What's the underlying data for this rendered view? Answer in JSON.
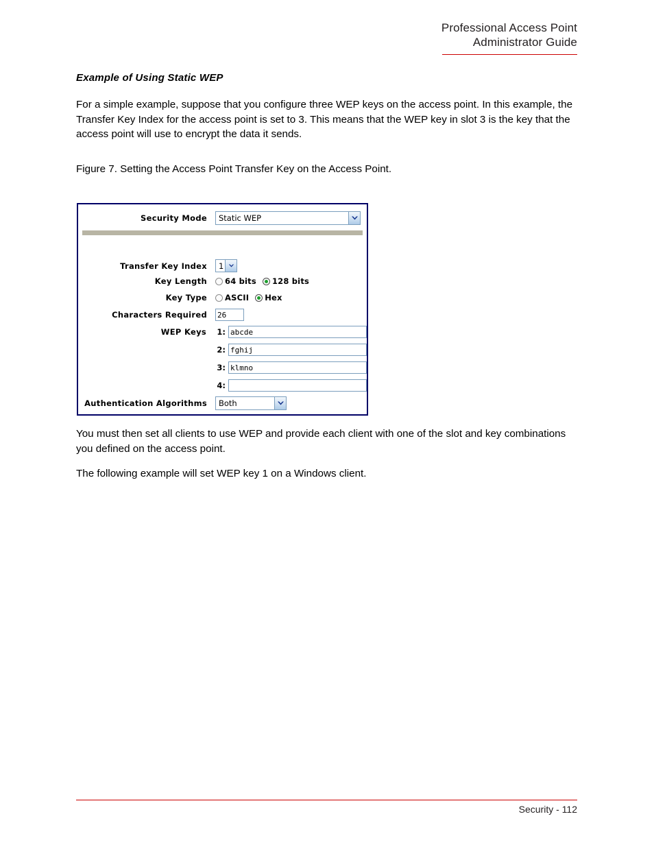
{
  "header": {
    "line1": "Professional Access Point",
    "line2": "Administrator Guide"
  },
  "content": {
    "section_heading": "Example of Using Static WEP",
    "intro_paragraph": "For a simple example, suppose that you configure three WEP keys on the access point. In this example, the Transfer Key Index for the access point is set to 3. This means that the WEP key in slot 3 is the key that the access point will use to encrypt the data it sends.",
    "figure_caption": "Figure 7. Setting the Access Point Transfer Key on the Access Point.",
    "after_paragraph": "You must then set all clients to use WEP and provide each client with one of the slot and key combinations you defined on the access point.",
    "last_paragraph": "The following example will set WEP key 1 on a Windows client."
  },
  "figure": {
    "security_mode": {
      "label": "Security Mode",
      "value": "Static WEP"
    },
    "transfer_key_index": {
      "label": "Transfer Key Index",
      "value": "1"
    },
    "key_length": {
      "label": "Key Length",
      "options": [
        {
          "label": "64 bits",
          "selected": false
        },
        {
          "label": "128 bits",
          "selected": true
        }
      ]
    },
    "key_type": {
      "label": "Key Type",
      "options": [
        {
          "label": "ASCII",
          "selected": false
        },
        {
          "label": "Hex",
          "selected": true
        }
      ]
    },
    "characters_required": {
      "label": "Characters Required",
      "value": "26"
    },
    "wep_keys": {
      "label": "WEP Keys",
      "rows": [
        {
          "num": "1:",
          "value": "abcde"
        },
        {
          "num": "2:",
          "value": "fghij"
        },
        {
          "num": "3:",
          "value": "klmno"
        },
        {
          "num": "4:",
          "value": ""
        }
      ]
    },
    "authentication_algorithms": {
      "label": "Authentication Algorithms",
      "value": "Both"
    }
  },
  "footer": {
    "text": "Security - 112"
  },
  "colors": {
    "rule_red": "#cc0000",
    "figure_border": "#000066",
    "separator_bar": "#b8b5a4",
    "input_border": "#7b9ebd",
    "radio_selected": "#1e9e2e"
  }
}
